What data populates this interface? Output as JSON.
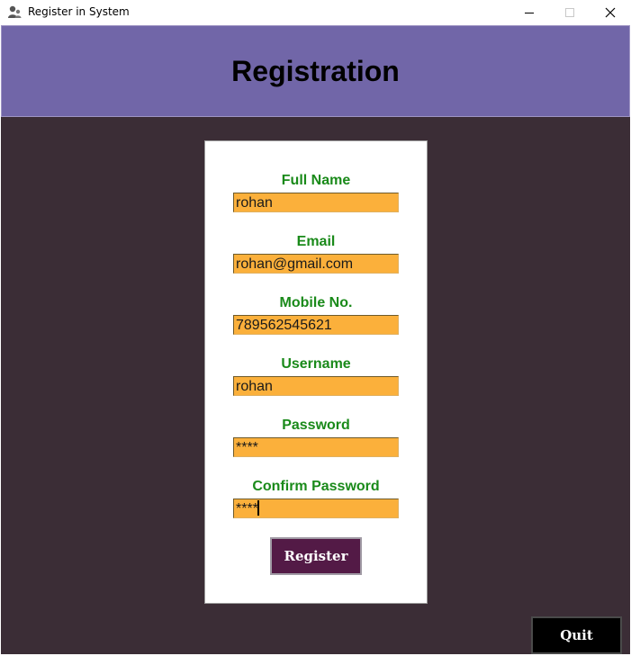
{
  "window": {
    "title": "Register in System",
    "icon": "users-icon"
  },
  "header": {
    "title": "Registration"
  },
  "colors": {
    "header_bg": "#7166a8",
    "body_bg": "#3b2d36",
    "input_bg": "#fbb03b",
    "label_color": "#1a8a1a",
    "register_bg": "#531a46",
    "quit_bg": "#000000"
  },
  "form": {
    "fields": [
      {
        "label": "Full Name",
        "value": "rohan"
      },
      {
        "label": "Email",
        "value": "rohan@gmail.com"
      },
      {
        "label": "Mobile No.",
        "value": "789562545621"
      },
      {
        "label": "Username",
        "value": "rohan"
      },
      {
        "label": "Password",
        "value": "****"
      },
      {
        "label": "Confirm Password",
        "value": "****"
      }
    ],
    "register_label": "Register"
  },
  "footer": {
    "quit_label": "Quit"
  }
}
